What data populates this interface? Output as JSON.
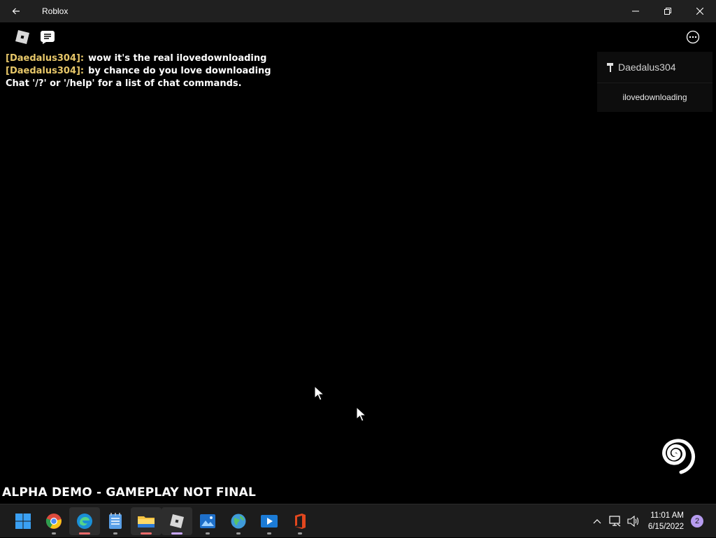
{
  "window": {
    "title": "Roblox"
  },
  "chat": {
    "messages": [
      {
        "speaker": "[Daedalus304]:",
        "text": "wow it's the real ilovedownloading"
      },
      {
        "speaker": "[Daedalus304]:",
        "text": "by chance do you love downloading"
      }
    ],
    "system_message": "Chat '/?' or '/help' for a list of chat commands."
  },
  "playerlist": {
    "header": "Daedalus304",
    "players": [
      "ilovedownloading"
    ]
  },
  "banner": "ALPHA DEMO - GAMEPLAY NOT FINAL",
  "taskbar": {
    "apps": [
      "windows-start-icon",
      "chrome-icon",
      "edge-icon",
      "notepad-icon",
      "file-explorer-icon",
      "roblox-icon",
      "photos-icon",
      "maps-icon",
      "media-player-icon",
      "office-icon"
    ],
    "time": "11:01 AM",
    "date": "6/15/2022",
    "notification_count": "2"
  },
  "colors": {
    "chat_speaker": "#e7c769",
    "titlebar": "#202020",
    "taskbar": "#1c1c1c",
    "accent": "#c9a7ff"
  }
}
